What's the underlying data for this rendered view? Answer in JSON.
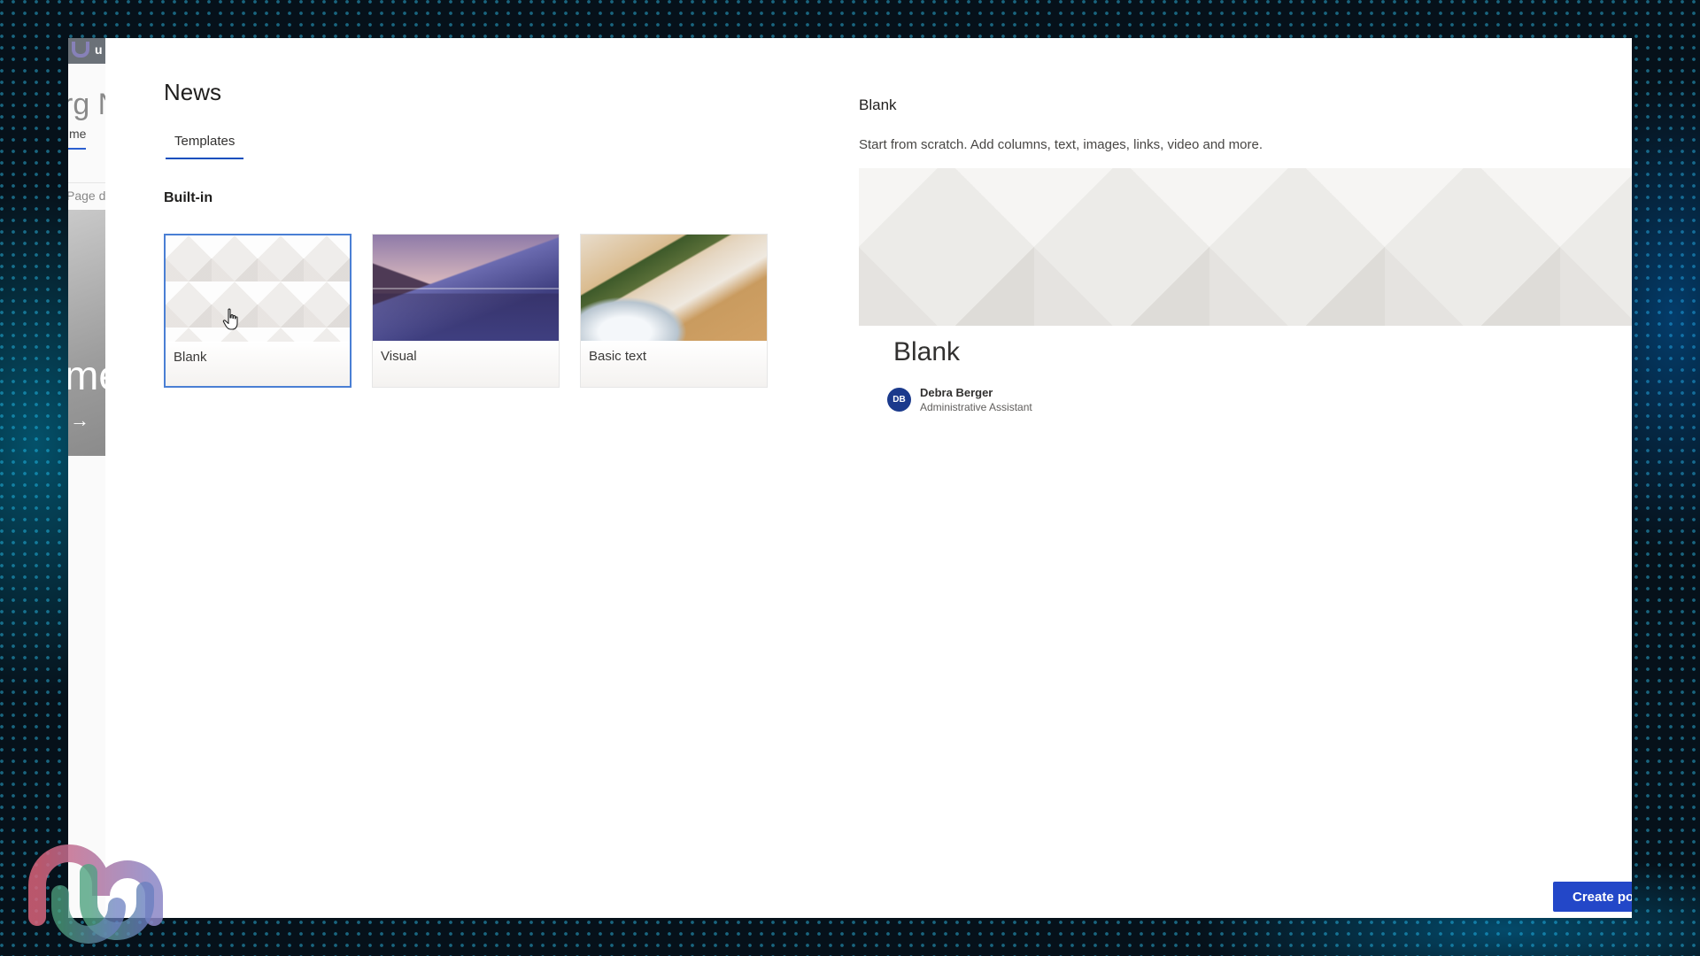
{
  "background_site": {
    "header_text": "u",
    "title_partial": "rg N",
    "nav_partial": "me",
    "page_partial": "Page d",
    "hero_partial": "me",
    "hero_arrow": "→"
  },
  "dialog": {
    "title": "News",
    "tabs": [
      {
        "label": "Templates",
        "active": true
      }
    ],
    "section_label": "Built-in",
    "templates": [
      {
        "label": "Blank",
        "selected": true,
        "thumbnail": "geometric-white-pattern"
      },
      {
        "label": "Visual",
        "selected": false,
        "thumbnail": "misty-lake-mountains"
      },
      {
        "label": "Basic text",
        "selected": false,
        "thumbnail": "aerial-beach-boats"
      }
    ]
  },
  "preview": {
    "title": "Blank",
    "description": "Start from scratch. Add columns, text, images, links, video and more.",
    "page_title": "Blank",
    "author": {
      "initials": "DB",
      "name": "Debra Berger",
      "role": "Administrative Assistant",
      "avatar_color": "#1b3a8c"
    }
  },
  "actions": {
    "create_label": "Create po",
    "create_color": "#2347c8"
  },
  "icons": {
    "cursor": "hand-pointer-icon",
    "watermark": "m-logo-watermark"
  }
}
